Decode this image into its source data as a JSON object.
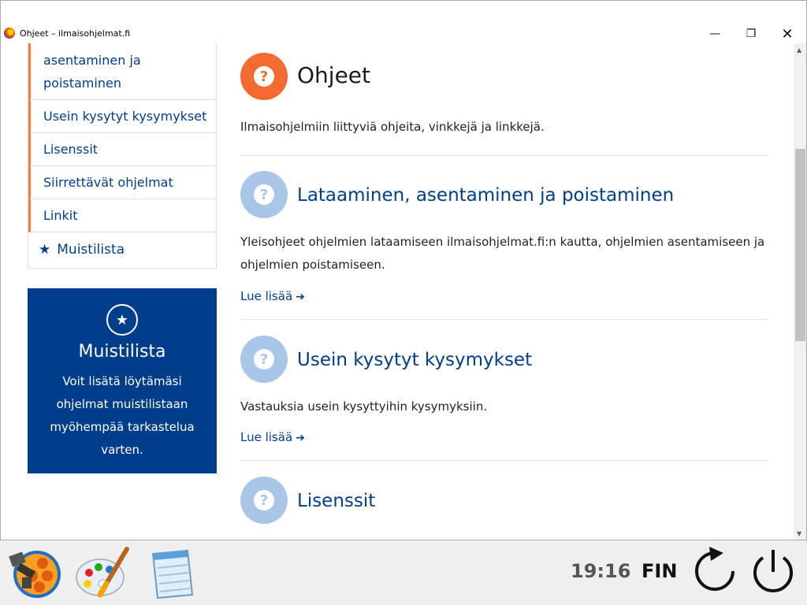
{
  "window": {
    "title": "Ohjeet – ilmaisohjelmat.fi",
    "minimize_glyph": "—",
    "maximize_glyph": "❐",
    "close_glyph": "✕"
  },
  "sidebar": {
    "items": [
      {
        "label": "asentaminen ja poistaminen"
      },
      {
        "label": "Usein kysytyt kysymykset"
      },
      {
        "label": "Lisenssit"
      },
      {
        "label": "Siirrettävät ohjelmat"
      },
      {
        "label": "Linkit"
      }
    ],
    "favorites_label": "Muistilista",
    "favorites_icon": "star-icon"
  },
  "promo": {
    "title": "Muistilista",
    "text": "Voit lisätä löytämäsi ohjelmat muistilistaan myöhempää tarkastelua varten.",
    "icon": "star-icon",
    "bg_color": "#003e8c"
  },
  "main": {
    "title": "Ohjeet",
    "description": "Ilmaisohjelmiin liittyviä ohjeita, vinkkejä ja linkkejä.",
    "header_icon_color": "#f46a30",
    "sections": [
      {
        "title": "Lataaminen, asentaminen ja poistaminen",
        "description": "Yleisohjeet ohjelmien lataamiseen ilmaisohjelmat.fi:n kautta, ohjelmien asentamiseen ja ohjelmien poistamiseen.",
        "link": "Lue lisää"
      },
      {
        "title": "Usein kysytyt kysymykset",
        "description": "Vastauksia usein kysyttyihin kysymyksiin.",
        "link": "Lue lisää"
      },
      {
        "title": "Lisenssit"
      }
    ],
    "section_icon_color": "#a9c6e8",
    "link_color": "#003e8c"
  },
  "taskbar": {
    "clock": "19:16",
    "language": "FIN",
    "apps": [
      "file-manager-icon",
      "paint-icon",
      "notepad-icon"
    ],
    "controls": [
      "refresh-icon",
      "power-icon"
    ]
  }
}
